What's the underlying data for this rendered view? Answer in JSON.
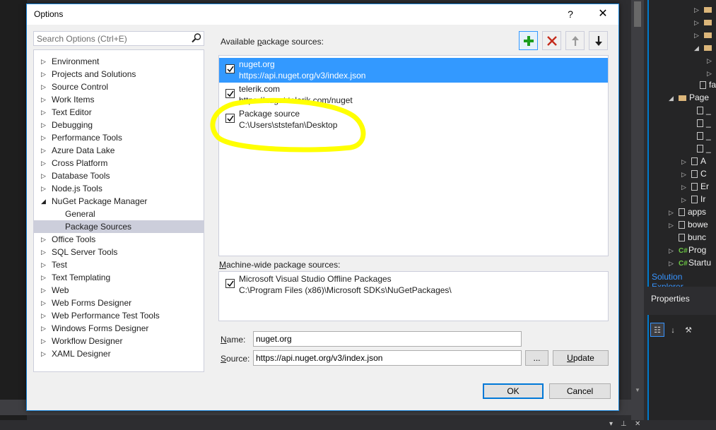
{
  "dialog": {
    "title": "Options",
    "help_label": "?",
    "close_label": "✕"
  },
  "search": {
    "placeholder": "Search Options (Ctrl+E)"
  },
  "tree": {
    "items": [
      {
        "label": "Environment",
        "expanded": false
      },
      {
        "label": "Projects and Solutions",
        "expanded": false
      },
      {
        "label": "Source Control",
        "expanded": false
      },
      {
        "label": "Work Items",
        "expanded": false
      },
      {
        "label": "Text Editor",
        "expanded": false
      },
      {
        "label": "Debugging",
        "expanded": false
      },
      {
        "label": "Performance Tools",
        "expanded": false
      },
      {
        "label": "Azure Data Lake",
        "expanded": false
      },
      {
        "label": "Cross Platform",
        "expanded": false
      },
      {
        "label": "Database Tools",
        "expanded": false
      },
      {
        "label": "Node.js Tools",
        "expanded": false
      },
      {
        "label": "NuGet Package Manager",
        "expanded": true
      },
      {
        "label": "General",
        "child": true
      },
      {
        "label": "Package Sources",
        "child": true,
        "selected": true
      },
      {
        "label": "Office Tools",
        "expanded": false
      },
      {
        "label": "SQL Server Tools",
        "expanded": false
      },
      {
        "label": "Test",
        "expanded": false
      },
      {
        "label": "Text Templating",
        "expanded": false
      },
      {
        "label": "Web",
        "expanded": false
      },
      {
        "label": "Web Forms Designer",
        "expanded": false
      },
      {
        "label": "Web Performance Test Tools",
        "expanded": false
      },
      {
        "label": "Windows Forms Designer",
        "expanded": false
      },
      {
        "label": "Workflow Designer",
        "expanded": false
      },
      {
        "label": "XAML Designer",
        "expanded": false
      }
    ]
  },
  "available": {
    "label_pre": "Available ",
    "label_accel": "p",
    "label_post": "ackage sources:",
    "sources": [
      {
        "name": "nuget.org",
        "url": "https://api.nuget.org/v3/index.json",
        "checked": true,
        "selected": true
      },
      {
        "name": "telerik.com",
        "url": "https://nuget.telerik.com/nuget",
        "checked": true,
        "selected": false
      },
      {
        "name": "Package source",
        "url": "C:\\Users\\ststefan\\Desktop",
        "checked": true,
        "selected": false
      }
    ]
  },
  "toolbar": {
    "add_icon": "plus-icon",
    "remove_icon": "x-icon",
    "up_icon": "arrow-up-icon",
    "down_icon": "arrow-down-icon"
  },
  "machine_wide": {
    "label_accel": "M",
    "label_post": "achine-wide package sources:",
    "sources": [
      {
        "name": "Microsoft Visual Studio Offline Packages",
        "url": "C:\\Program Files (x86)\\Microsoft SDKs\\NuGetPackages\\",
        "checked": true
      }
    ]
  },
  "form": {
    "name_accel": "N",
    "name_post": "ame:",
    "name_value": "nuget.org",
    "source_accel": "S",
    "source_post": "ource:",
    "source_value": "https://api.nuget.org/v3/index.json",
    "browse_label": "...",
    "update_accel": "U",
    "update_post": "pdate"
  },
  "footer": {
    "ok_label": "OK",
    "cancel_label": "Cancel"
  },
  "background": {
    "solution_explorer_rows": [
      "fa",
      "Page",
      "_",
      "_",
      "_",
      "_",
      "A",
      "C",
      "Er",
      "Ir",
      "apps",
      "bowe",
      "bunc",
      "Prog",
      "Startu"
    ],
    "solution_explorer_tab": "Solution Explorer",
    "properties_title": "Properties"
  },
  "colors": {
    "accent": "#3399ff",
    "highlight_ellipse": "#ffff00",
    "add_green": "#1e9e1e",
    "remove_red": "#c42b1c"
  }
}
